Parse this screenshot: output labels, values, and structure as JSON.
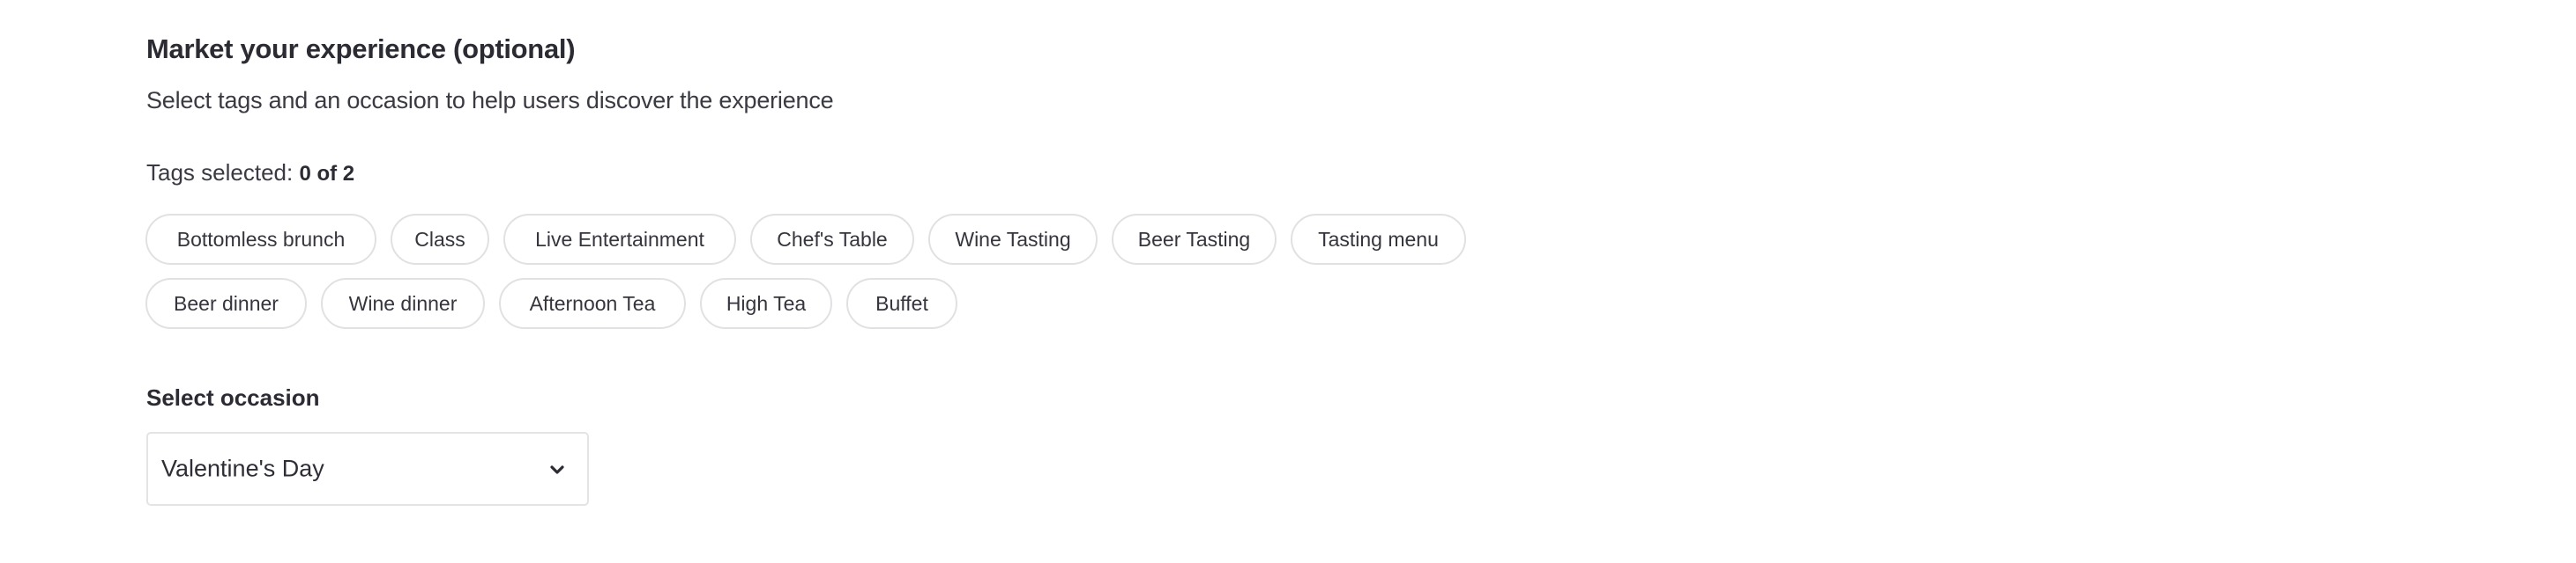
{
  "section": {
    "title": "Market your experience (optional)",
    "subtitle": "Select tags and an occasion to help users discover the experience"
  },
  "tags": {
    "count_label": "Tags selected:",
    "selected_count": 0,
    "max_count": 2,
    "count_value": "0 of 2",
    "rows": [
      [
        {
          "label": "Bottomless brunch",
          "selected": false
        },
        {
          "label": "Class",
          "selected": false
        },
        {
          "label": "Live Entertainment",
          "selected": false
        },
        {
          "label": "Chef's Table",
          "selected": false
        },
        {
          "label": "Wine Tasting",
          "selected": false
        },
        {
          "label": "Beer Tasting",
          "selected": false
        },
        {
          "label": "Tasting menu",
          "selected": false
        }
      ],
      [
        {
          "label": "Beer dinner",
          "selected": false
        },
        {
          "label": "Wine dinner",
          "selected": false
        },
        {
          "label": "Afternoon Tea",
          "selected": false
        },
        {
          "label": "High Tea",
          "selected": false
        },
        {
          "label": "Buffet",
          "selected": false
        }
      ]
    ]
  },
  "occasion": {
    "label": "Select occasion",
    "selected_value": "Valentine's Day",
    "icon": "chevron-down-icon"
  },
  "colors": {
    "text_primary": "#2b2c33",
    "chip_border": "#e1e1e3",
    "select_border": "#e4e4e6",
    "background": "#ffffff"
  }
}
